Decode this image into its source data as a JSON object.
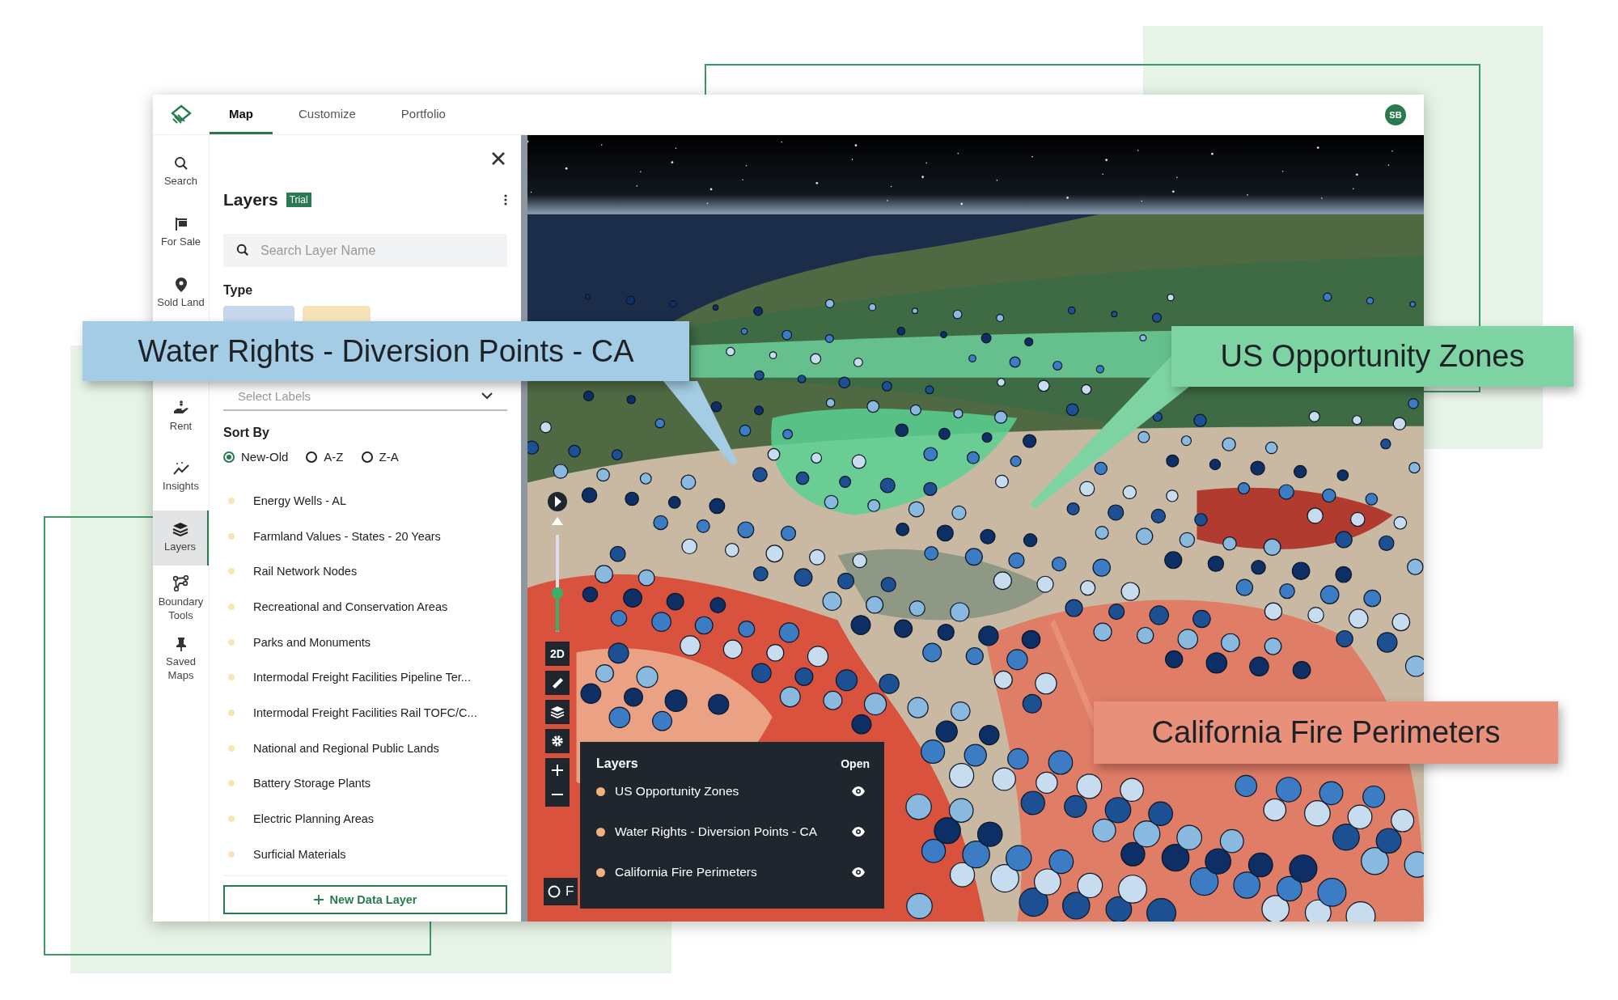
{
  "top_bar": {
    "tabs": [
      {
        "label": "Map",
        "selected": true
      },
      {
        "label": "Customize",
        "selected": false
      },
      {
        "label": "Portfolio",
        "selected": false
      }
    ],
    "avatar": "SB"
  },
  "rail": [
    {
      "kind": "search",
      "label": "Search",
      "selected": false
    },
    {
      "kind": "sale",
      "label": "For Sale",
      "selected": false
    },
    {
      "kind": "pin",
      "label": "Sold Land",
      "selected": false
    },
    {
      "kind": "rent",
      "label": "Rent",
      "selected": false
    },
    {
      "kind": "insights",
      "label": "Insights",
      "selected": false
    },
    {
      "kind": "layers",
      "label": "Layers",
      "selected": true
    },
    {
      "kind": "boundary",
      "label": "Boundary Tools",
      "selected": false
    },
    {
      "kind": "saved",
      "label": "Saved Maps",
      "selected": false
    }
  ],
  "panel": {
    "title": "Layers",
    "badge": "Trial",
    "search": {
      "placeholder": "Search Layer Name"
    },
    "type_heading": "Type",
    "labels_select": {
      "placeholder": "Select Labels"
    },
    "sort_heading": "Sort By",
    "sort_options": [
      {
        "label": "New-Old",
        "selected": true
      },
      {
        "label": "A-Z",
        "selected": false
      },
      {
        "label": "Z-A",
        "selected": false
      }
    ],
    "layers": [
      "Energy Wells - AL",
      "Farmland Values - States - 20 Years",
      "Rail Network Nodes",
      "Recreational and Conservation Areas",
      "Parks and Monuments",
      "Intermodal Freight Facilities Pipeline Ter...",
      "Intermodal Freight Facilities Rail TOFC/C...",
      "National and Regional Public Lands",
      "Battery Storage Plants",
      "Electric Planning Areas",
      "Surficial Materials"
    ],
    "new_button": "New Data Layer"
  },
  "map": {
    "controls": {
      "pitch_slider": {
        "level": 0.4
      },
      "mode_button": "2D",
      "radio": {
        "label": "F",
        "selected": false
      }
    },
    "legend": {
      "title": "Layers",
      "action": "Open",
      "items": [
        {
          "name": "US Opportunity Zones",
          "visible": true
        },
        {
          "name": "Water Rights - Diversion Points - CA",
          "visible": true
        },
        {
          "name": "California Fire Perimeters",
          "visible": true
        }
      ]
    }
  },
  "callouts": [
    {
      "text": "Water Rights - Diversion Points - CA",
      "color": "#a4cce4"
    },
    {
      "text": "US Opportunity Zones",
      "color": "#7dd4a2"
    },
    {
      "text": "California Fire Perimeters",
      "color": "#e8907a"
    }
  ]
}
